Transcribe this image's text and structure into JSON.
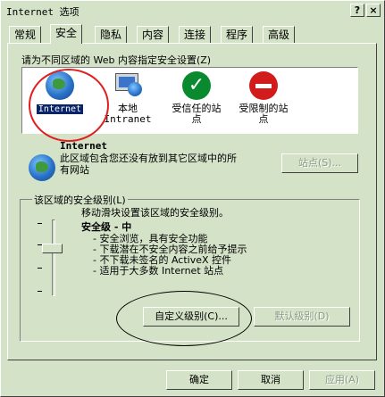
{
  "window": {
    "title": "Internet 选项",
    "help_btn": "?",
    "close_btn": "×"
  },
  "tabs": [
    "常规",
    "安全",
    "隐私",
    "内容",
    "连接",
    "程序",
    "高级"
  ],
  "active_tab": "安全",
  "zones": {
    "prompt": "请为不同区域的 Web 内容指定安全设置(Z)",
    "items": [
      {
        "label": "Internet",
        "selected": true
      },
      {
        "label": "本地\nIntranet",
        "selected": false
      },
      {
        "label": "受信任的站\n点",
        "selected": false
      },
      {
        "label": "受限制的站\n点",
        "selected": false
      }
    ]
  },
  "zone_info": {
    "name": "Internet",
    "description": "此区域包含您还没有放到其它区域中的所有网站",
    "sites_button": "站点(S)..."
  },
  "security_level": {
    "group_label": "该区域的安全级别(L)",
    "intro": "移动滑块设置该区域的安全级别。",
    "level_name": "安全级 - 中",
    "bullets": [
      "安全浏览，具有安全功能",
      "下载潜在不安全内容之前给予提示",
      "不下载未签名的 ActiveX 控件",
      "适用于大多数 Internet 站点"
    ],
    "custom_button": "自定义级别(C)...",
    "default_button": "默认级别(D)"
  },
  "footer": {
    "ok": "确定",
    "cancel": "取消",
    "apply": "应用(A)"
  }
}
